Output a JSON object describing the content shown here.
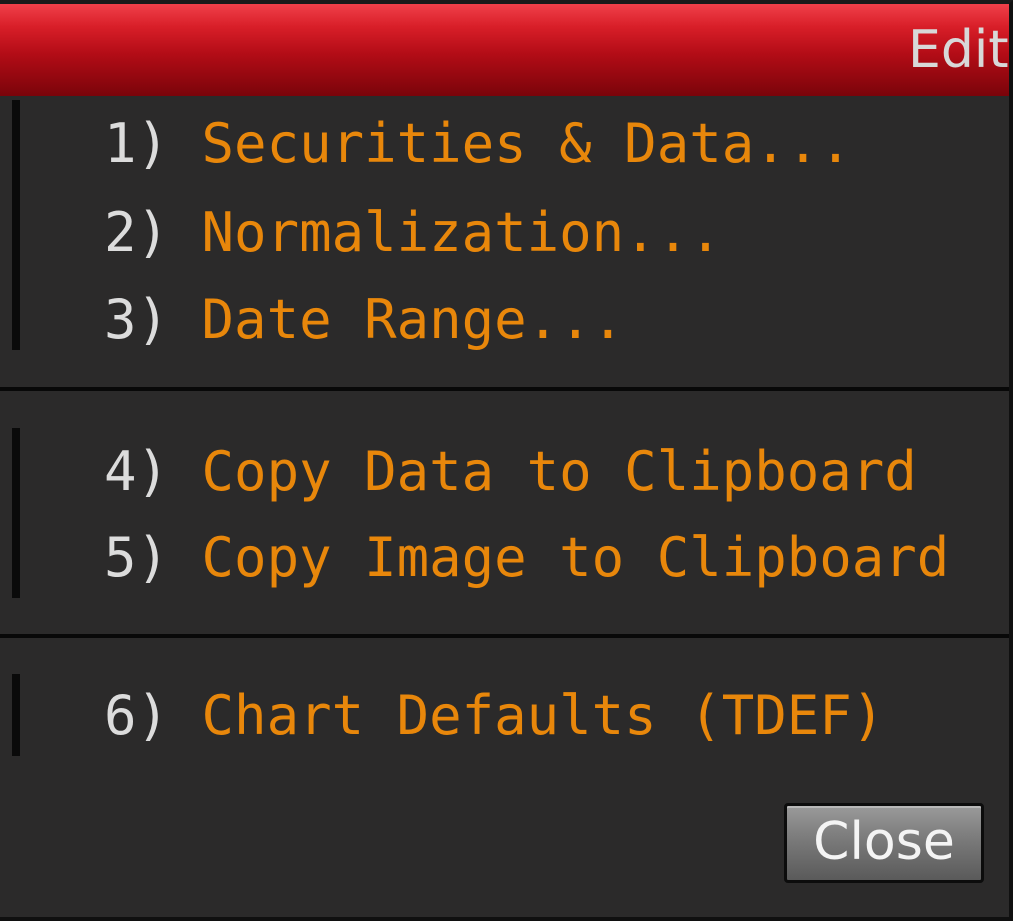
{
  "window": {
    "title": "Edit"
  },
  "menu": {
    "groups": [
      {
        "items": [
          {
            "number": "1)",
            "label": "Securities & Data..."
          },
          {
            "number": "2)",
            "label": "Normalization..."
          },
          {
            "number": "3)",
            "label": "Date Range..."
          }
        ]
      },
      {
        "items": [
          {
            "number": "4)",
            "label": "Copy Data to Clipboard"
          },
          {
            "number": "5)",
            "label": "Copy Image to Clipboard"
          }
        ]
      },
      {
        "items": [
          {
            "number": "6)",
            "label": "Chart Defaults (TDEF)"
          }
        ]
      }
    ]
  },
  "footer": {
    "close_label": "Close"
  },
  "colors": {
    "title_bar": "#c8101c",
    "background": "#2b2a2a",
    "item_label": "#e8870b",
    "item_number": "#dcdcdc"
  }
}
